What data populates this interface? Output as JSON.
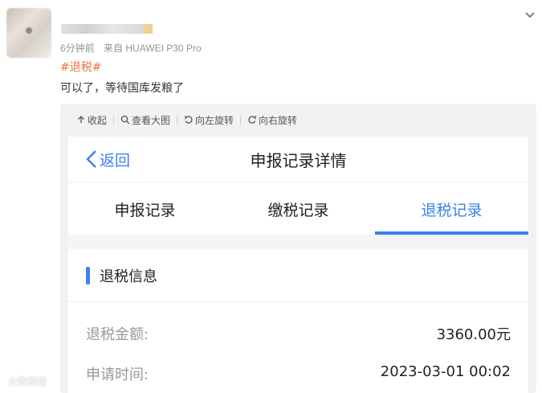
{
  "post": {
    "time": "6分钟前",
    "source": "来自 HUAWEI P30 Pro",
    "hashtag": "#退税#",
    "text": "可以了，等待国库发粮了"
  },
  "toolbar": {
    "collapse": "收起",
    "view_large": "查看大图",
    "rotate_left": "向左旋转",
    "rotate_right": "向右旋转"
  },
  "screenshot": {
    "back": "返回",
    "title": "申报记录详情",
    "tabs": [
      {
        "label": "申报记录",
        "active": false
      },
      {
        "label": "缴税记录",
        "active": false
      },
      {
        "label": "退税记录",
        "active": true
      }
    ],
    "section_title": "退税信息",
    "rows": [
      {
        "label": "退税金额:",
        "value": "3360.00元"
      },
      {
        "label": "申请时间:",
        "value": "2023-03-01 00:02"
      }
    ]
  },
  "watermark": "大数跨境",
  "colors": {
    "accent_blue": "#3a82ee",
    "hashtag_orange": "#eb7340"
  }
}
